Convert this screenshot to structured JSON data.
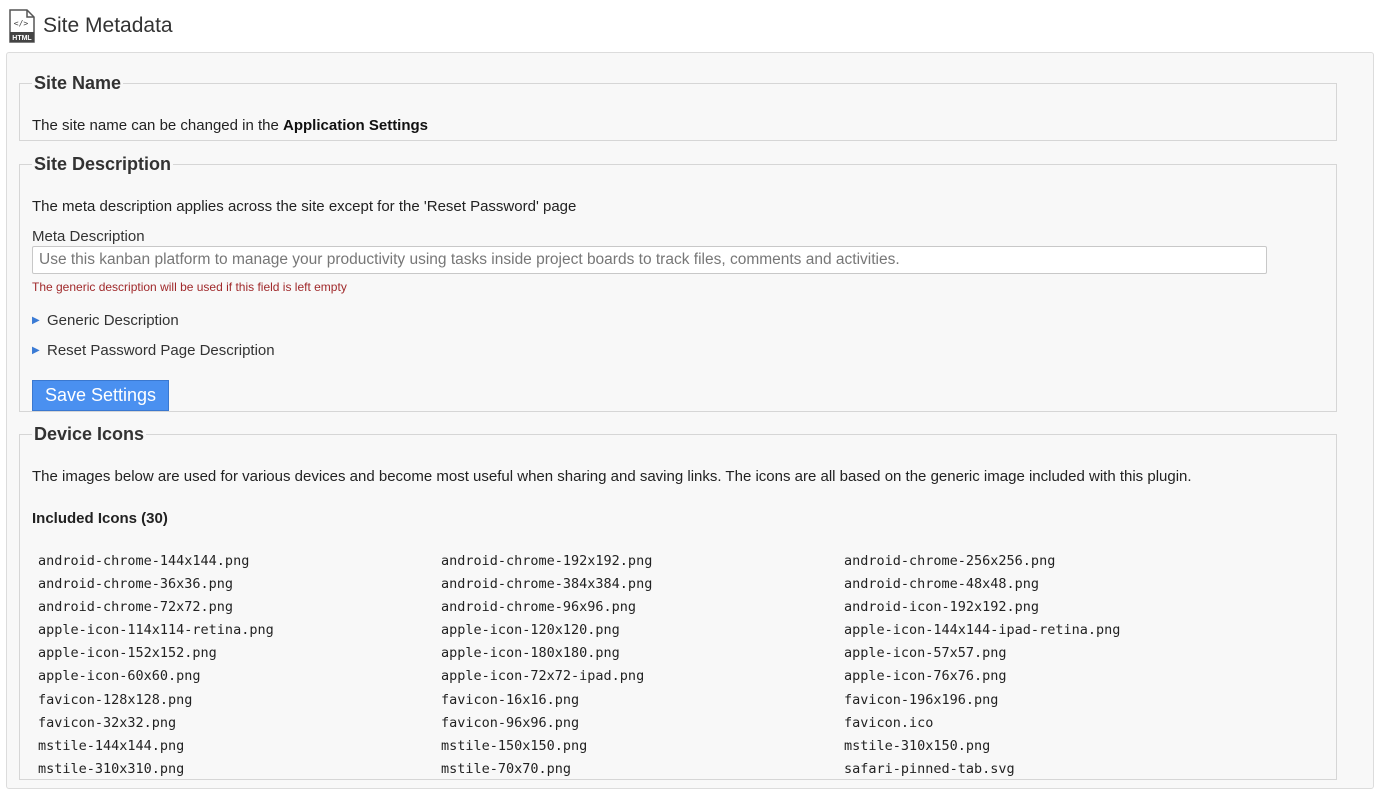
{
  "header": {
    "icon": "html-file-icon",
    "icon_label": "HTML",
    "title": "Site Metadata"
  },
  "site_name": {
    "legend": "Site Name",
    "text_prefix": "The site name can be changed in the ",
    "text_link": "Application Settings"
  },
  "site_description": {
    "legend": "Site Description",
    "intro": "The meta description applies across the site except for the 'Reset Password' page",
    "field_label": "Meta Description",
    "field_value": "",
    "field_placeholder": "Use this kanban platform to manage your productivity using tasks inside project boards to track files, comments and activities.",
    "helper": "The generic description will be used if this field is left empty",
    "disclosures": [
      "Generic Description",
      "Reset Password Page Description"
    ],
    "save_label": "Save Settings"
  },
  "device_icons": {
    "legend": "Device Icons",
    "intro": "The images below are used for various devices and become most useful when sharing and saving links. The icons are all based on the generic image included with this plugin.",
    "included_heading": "Included Icons (30)",
    "files": [
      "android-chrome-144x144.png",
      "android-chrome-192x192.png",
      "android-chrome-256x256.png",
      "android-chrome-36x36.png",
      "android-chrome-384x384.png",
      "android-chrome-48x48.png",
      "android-chrome-72x72.png",
      "android-chrome-96x96.png",
      "android-icon-192x192.png",
      "apple-icon-114x114-retina.png",
      "apple-icon-120x120.png",
      "apple-icon-144x144-ipad-retina.png",
      "apple-icon-152x152.png",
      "apple-icon-180x180.png",
      "apple-icon-57x57.png",
      "apple-icon-60x60.png",
      "apple-icon-72x72-ipad.png",
      "apple-icon-76x76.png",
      "favicon-128x128.png",
      "favicon-16x16.png",
      "favicon-196x196.png",
      "favicon-32x32.png",
      "favicon-96x96.png",
      "favicon.ico",
      "mstile-144x144.png",
      "mstile-150x150.png",
      "mstile-310x150.png",
      "mstile-310x310.png",
      "mstile-70x70.png",
      "safari-pinned-tab.svg"
    ]
  },
  "colors": {
    "accent": "#4a90f0",
    "helper_text": "#a0292b",
    "panel_bg": "#f8f8f8"
  }
}
